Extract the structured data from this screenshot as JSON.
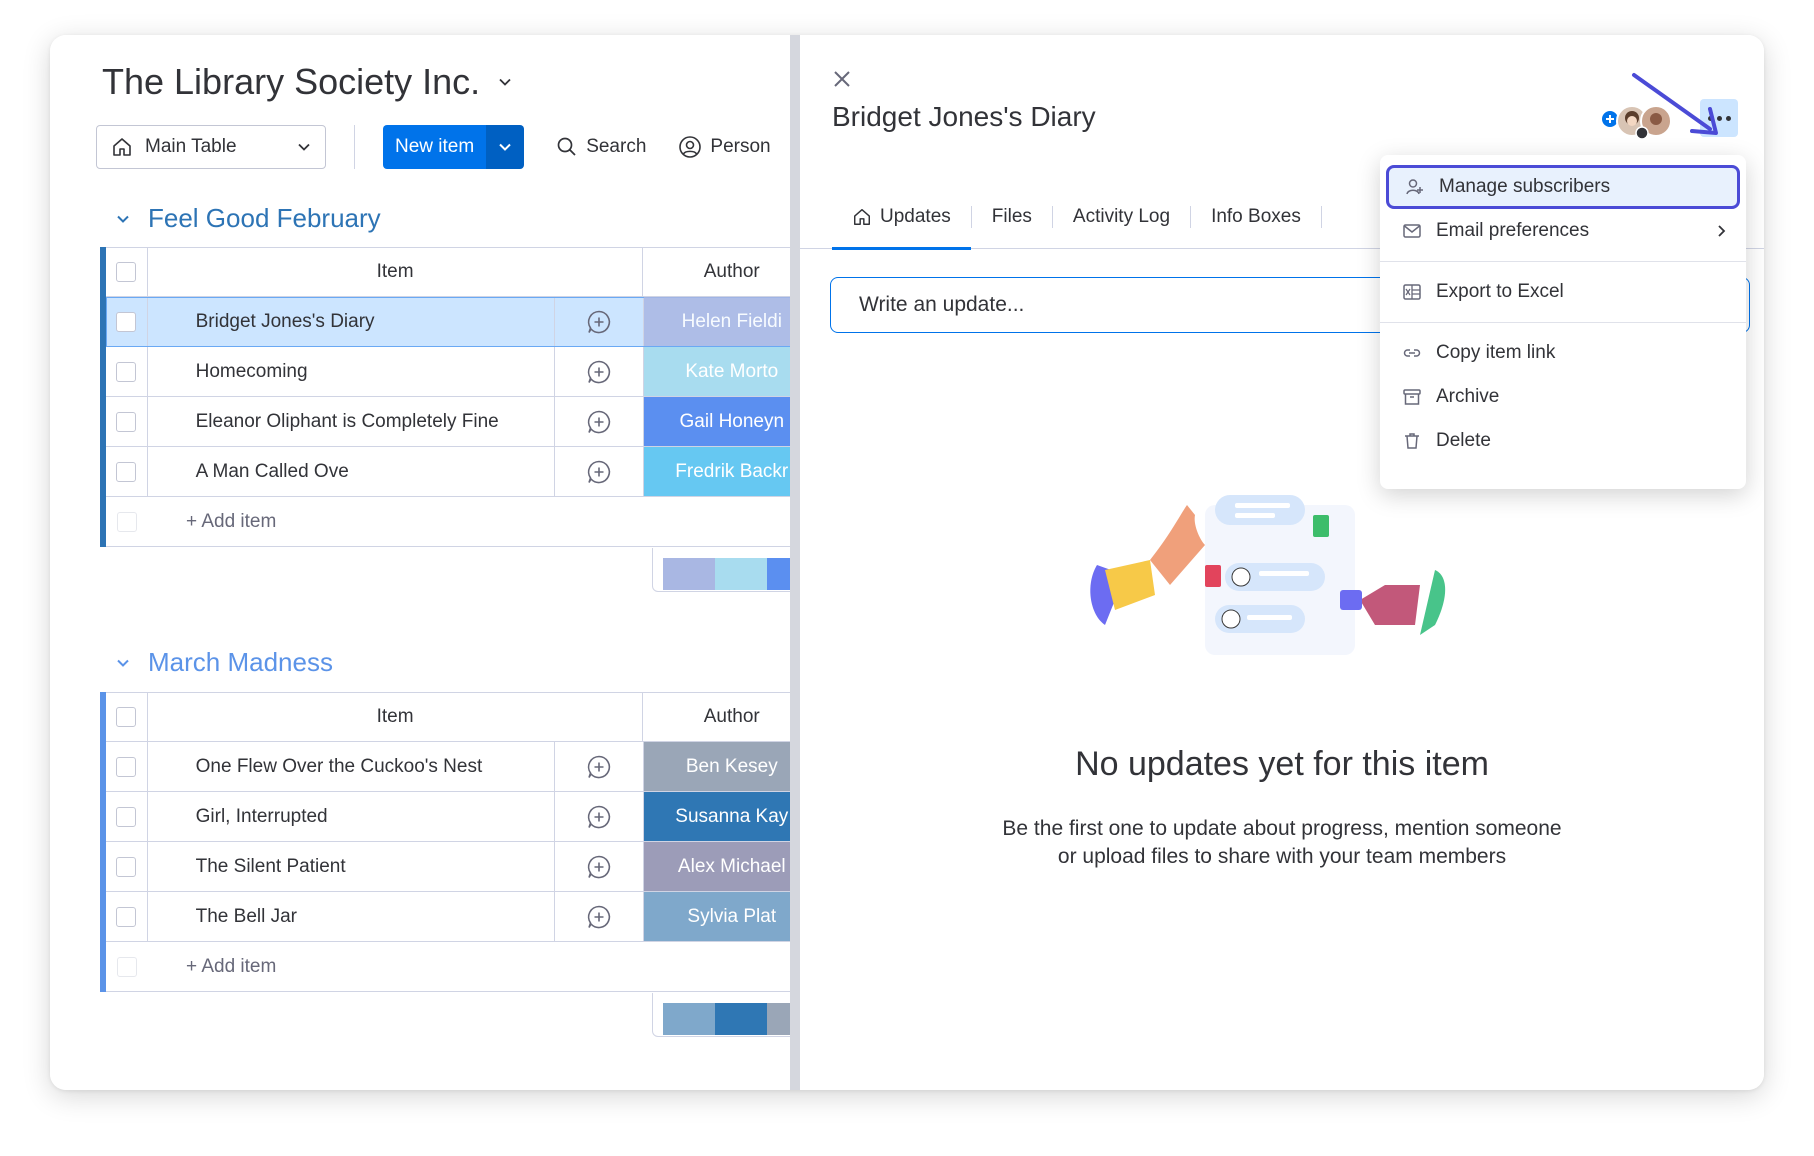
{
  "board": {
    "title": "The Library Society Inc.",
    "toolbar": {
      "view": "Main Table",
      "new_item": "New item",
      "search": "Search",
      "person": "Person"
    },
    "groups": [
      {
        "title": "Feel Good February",
        "color": "#2d74b5",
        "header": {
          "item": "Item",
          "author": "Author"
        },
        "rows": [
          {
            "item": "Bridget Jones's Diary",
            "author": "Helen Fieldi",
            "author_color": "#a9b7e3"
          },
          {
            "item": "Homecoming",
            "author": "Kate Morto",
            "author_color": "#a8dcef"
          },
          {
            "item": "Eleanor Oliphant is Completely Fine",
            "author": "Gail Honeyn",
            "author_color": "#5b8ff0"
          },
          {
            "item": "A Man Called Ove",
            "author": "Fredrik Backr",
            "author_color": "#66c8f2"
          }
        ],
        "add_item": "+ Add item"
      },
      {
        "title": "March Madness",
        "color": "#5b93e8",
        "header": {
          "item": "Item",
          "author": "Author"
        },
        "rows": [
          {
            "item": "One Flew Over the Cuckoo's Nest",
            "author": "Ben Kesey",
            "author_color": "#9aa6b7"
          },
          {
            "item": "Girl, Interrupted",
            "author": "Susanna Kay",
            "author_color": "#2f77b4"
          },
          {
            "item": "The Silent Patient",
            "author": "Alex Michael",
            "author_color": "#9c9cb8"
          },
          {
            "item": "The Bell Jar",
            "author": "Sylvia Plat",
            "author_color": "#7fa8cb"
          }
        ],
        "add_item": "+ Add item"
      }
    ]
  },
  "panel": {
    "item_title": "Bridget Jones's Diary",
    "tabs": [
      "Updates",
      "Files",
      "Activity Log",
      "Info Boxes"
    ],
    "active_tab": "Updates",
    "write_placeholder": "Write an update...",
    "empty_title": "No updates yet for this item",
    "empty_line1": "Be the first one to update about progress, mention someone",
    "empty_line2": "or upload files to share with your team members"
  },
  "menu": {
    "items": [
      {
        "label": "Manage subscribers",
        "icon": "add-person-icon"
      },
      {
        "label": "Email preferences",
        "icon": "envelope-icon"
      },
      {
        "label": "Export to Excel",
        "icon": "excel-icon"
      },
      {
        "label": "Copy item link",
        "icon": "link-icon"
      },
      {
        "label": "Archive",
        "icon": "archive-icon"
      },
      {
        "label": "Delete",
        "icon": "trash-icon"
      }
    ]
  },
  "colors": {
    "primary": "#0073ea",
    "highlight_border": "#4b4bd6",
    "selected_row": "#cce5ff"
  }
}
